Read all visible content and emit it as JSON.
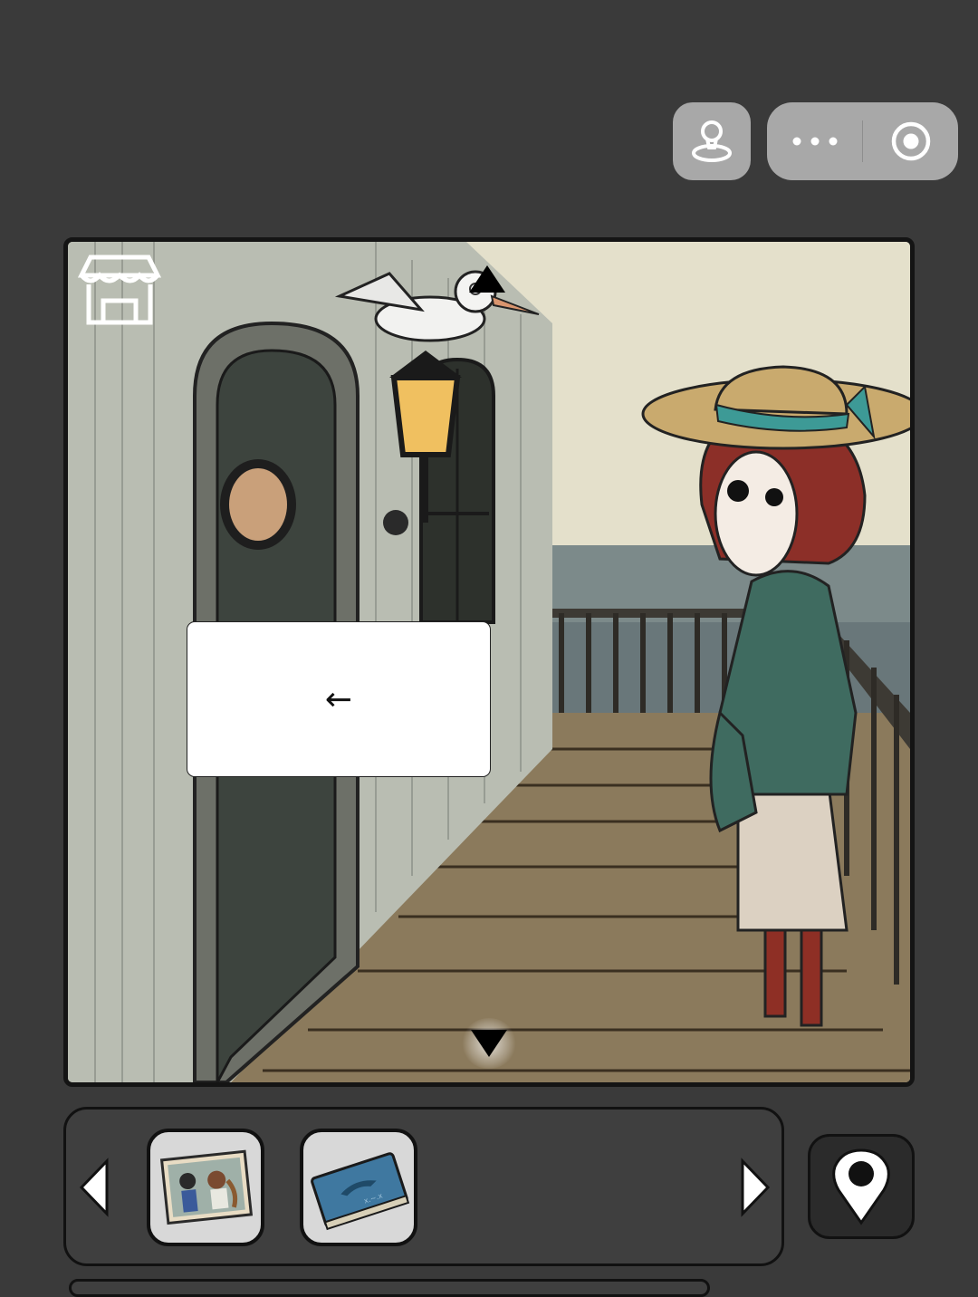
{
  "top_bar": {
    "joystick_icon": "joystick-icon",
    "more_icon": "more-dots-icon",
    "record_icon": "target-record-icon"
  },
  "scene": {
    "description_icons": [
      "shop-icon",
      "nav-up-arrow-icon",
      "nav-down-arrow-icon"
    ],
    "speech_text": "←"
  },
  "inventory": {
    "items": [
      {
        "name": "photo",
        "icon": "photo-icon"
      },
      {
        "name": "book",
        "icon": "blue-book-icon"
      }
    ],
    "left_arrow_icon": "triangle-left-icon",
    "right_arrow_icon": "triangle-right-icon",
    "map_icon": "location-pin-icon"
  },
  "colors": {
    "background": "#3a3a3a",
    "capsule": "#a8a8a8",
    "slot": "#d8d8d8",
    "speech_bubble": "#ffffff"
  }
}
